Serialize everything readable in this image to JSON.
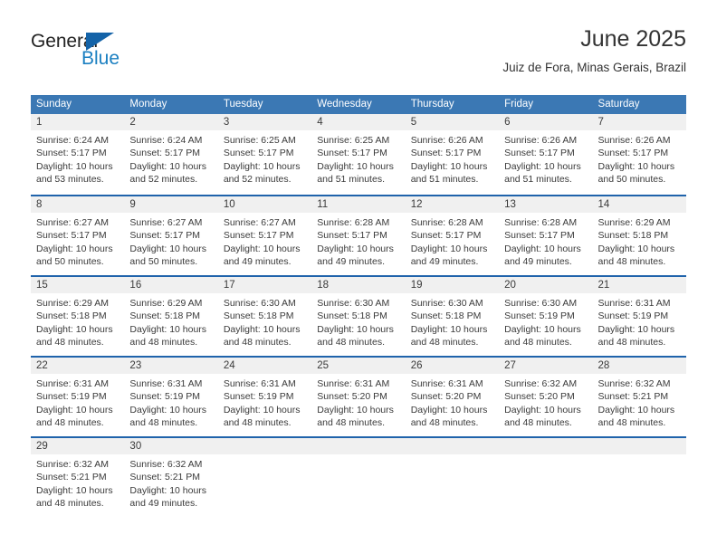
{
  "brand": {
    "name_part1": "General",
    "name_part2": "Blue",
    "triangle_icon": "triangle-icon",
    "color_primary": "#1463a8",
    "color_text": "#222222"
  },
  "header": {
    "title": "June 2025",
    "location": "Juiz de Fora, Minas Gerais, Brazil"
  },
  "theme": {
    "header_blue": "#3b78b4",
    "row_divider_blue": "#1f63ab",
    "day_band_gray": "#f0f0f0"
  },
  "weekdays": [
    "Sunday",
    "Monday",
    "Tuesday",
    "Wednesday",
    "Thursday",
    "Friday",
    "Saturday"
  ],
  "weeks": [
    [
      {
        "day": "1",
        "sunrise": "Sunrise: 6:24 AM",
        "sunset": "Sunset: 5:17 PM",
        "daylight1": "Daylight: 10 hours",
        "daylight2": "and 53 minutes."
      },
      {
        "day": "2",
        "sunrise": "Sunrise: 6:24 AM",
        "sunset": "Sunset: 5:17 PM",
        "daylight1": "Daylight: 10 hours",
        "daylight2": "and 52 minutes."
      },
      {
        "day": "3",
        "sunrise": "Sunrise: 6:25 AM",
        "sunset": "Sunset: 5:17 PM",
        "daylight1": "Daylight: 10 hours",
        "daylight2": "and 52 minutes."
      },
      {
        "day": "4",
        "sunrise": "Sunrise: 6:25 AM",
        "sunset": "Sunset: 5:17 PM",
        "daylight1": "Daylight: 10 hours",
        "daylight2": "and 51 minutes."
      },
      {
        "day": "5",
        "sunrise": "Sunrise: 6:26 AM",
        "sunset": "Sunset: 5:17 PM",
        "daylight1": "Daylight: 10 hours",
        "daylight2": "and 51 minutes."
      },
      {
        "day": "6",
        "sunrise": "Sunrise: 6:26 AM",
        "sunset": "Sunset: 5:17 PM",
        "daylight1": "Daylight: 10 hours",
        "daylight2": "and 51 minutes."
      },
      {
        "day": "7",
        "sunrise": "Sunrise: 6:26 AM",
        "sunset": "Sunset: 5:17 PM",
        "daylight1": "Daylight: 10 hours",
        "daylight2": "and 50 minutes."
      }
    ],
    [
      {
        "day": "8",
        "sunrise": "Sunrise: 6:27 AM",
        "sunset": "Sunset: 5:17 PM",
        "daylight1": "Daylight: 10 hours",
        "daylight2": "and 50 minutes."
      },
      {
        "day": "9",
        "sunrise": "Sunrise: 6:27 AM",
        "sunset": "Sunset: 5:17 PM",
        "daylight1": "Daylight: 10 hours",
        "daylight2": "and 50 minutes."
      },
      {
        "day": "10",
        "sunrise": "Sunrise: 6:27 AM",
        "sunset": "Sunset: 5:17 PM",
        "daylight1": "Daylight: 10 hours",
        "daylight2": "and 49 minutes."
      },
      {
        "day": "11",
        "sunrise": "Sunrise: 6:28 AM",
        "sunset": "Sunset: 5:17 PM",
        "daylight1": "Daylight: 10 hours",
        "daylight2": "and 49 minutes."
      },
      {
        "day": "12",
        "sunrise": "Sunrise: 6:28 AM",
        "sunset": "Sunset: 5:17 PM",
        "daylight1": "Daylight: 10 hours",
        "daylight2": "and 49 minutes."
      },
      {
        "day": "13",
        "sunrise": "Sunrise: 6:28 AM",
        "sunset": "Sunset: 5:17 PM",
        "daylight1": "Daylight: 10 hours",
        "daylight2": "and 49 minutes."
      },
      {
        "day": "14",
        "sunrise": "Sunrise: 6:29 AM",
        "sunset": "Sunset: 5:18 PM",
        "daylight1": "Daylight: 10 hours",
        "daylight2": "and 48 minutes."
      }
    ],
    [
      {
        "day": "15",
        "sunrise": "Sunrise: 6:29 AM",
        "sunset": "Sunset: 5:18 PM",
        "daylight1": "Daylight: 10 hours",
        "daylight2": "and 48 minutes."
      },
      {
        "day": "16",
        "sunrise": "Sunrise: 6:29 AM",
        "sunset": "Sunset: 5:18 PM",
        "daylight1": "Daylight: 10 hours",
        "daylight2": "and 48 minutes."
      },
      {
        "day": "17",
        "sunrise": "Sunrise: 6:30 AM",
        "sunset": "Sunset: 5:18 PM",
        "daylight1": "Daylight: 10 hours",
        "daylight2": "and 48 minutes."
      },
      {
        "day": "18",
        "sunrise": "Sunrise: 6:30 AM",
        "sunset": "Sunset: 5:18 PM",
        "daylight1": "Daylight: 10 hours",
        "daylight2": "and 48 minutes."
      },
      {
        "day": "19",
        "sunrise": "Sunrise: 6:30 AM",
        "sunset": "Sunset: 5:18 PM",
        "daylight1": "Daylight: 10 hours",
        "daylight2": "and 48 minutes."
      },
      {
        "day": "20",
        "sunrise": "Sunrise: 6:30 AM",
        "sunset": "Sunset: 5:19 PM",
        "daylight1": "Daylight: 10 hours",
        "daylight2": "and 48 minutes."
      },
      {
        "day": "21",
        "sunrise": "Sunrise: 6:31 AM",
        "sunset": "Sunset: 5:19 PM",
        "daylight1": "Daylight: 10 hours",
        "daylight2": "and 48 minutes."
      }
    ],
    [
      {
        "day": "22",
        "sunrise": "Sunrise: 6:31 AM",
        "sunset": "Sunset: 5:19 PM",
        "daylight1": "Daylight: 10 hours",
        "daylight2": "and 48 minutes."
      },
      {
        "day": "23",
        "sunrise": "Sunrise: 6:31 AM",
        "sunset": "Sunset: 5:19 PM",
        "daylight1": "Daylight: 10 hours",
        "daylight2": "and 48 minutes."
      },
      {
        "day": "24",
        "sunrise": "Sunrise: 6:31 AM",
        "sunset": "Sunset: 5:19 PM",
        "daylight1": "Daylight: 10 hours",
        "daylight2": "and 48 minutes."
      },
      {
        "day": "25",
        "sunrise": "Sunrise: 6:31 AM",
        "sunset": "Sunset: 5:20 PM",
        "daylight1": "Daylight: 10 hours",
        "daylight2": "and 48 minutes."
      },
      {
        "day": "26",
        "sunrise": "Sunrise: 6:31 AM",
        "sunset": "Sunset: 5:20 PM",
        "daylight1": "Daylight: 10 hours",
        "daylight2": "and 48 minutes."
      },
      {
        "day": "27",
        "sunrise": "Sunrise: 6:32 AM",
        "sunset": "Sunset: 5:20 PM",
        "daylight1": "Daylight: 10 hours",
        "daylight2": "and 48 minutes."
      },
      {
        "day": "28",
        "sunrise": "Sunrise: 6:32 AM",
        "sunset": "Sunset: 5:21 PM",
        "daylight1": "Daylight: 10 hours",
        "daylight2": "and 48 minutes."
      }
    ],
    [
      {
        "day": "29",
        "sunrise": "Sunrise: 6:32 AM",
        "sunset": "Sunset: 5:21 PM",
        "daylight1": "Daylight: 10 hours",
        "daylight2": "and 48 minutes."
      },
      {
        "day": "30",
        "sunrise": "Sunrise: 6:32 AM",
        "sunset": "Sunset: 5:21 PM",
        "daylight1": "Daylight: 10 hours",
        "daylight2": "and 49 minutes."
      },
      {
        "day": "",
        "sunrise": "",
        "sunset": "",
        "daylight1": "",
        "daylight2": ""
      },
      {
        "day": "",
        "sunrise": "",
        "sunset": "",
        "daylight1": "",
        "daylight2": ""
      },
      {
        "day": "",
        "sunrise": "",
        "sunset": "",
        "daylight1": "",
        "daylight2": ""
      },
      {
        "day": "",
        "sunrise": "",
        "sunset": "",
        "daylight1": "",
        "daylight2": ""
      },
      {
        "day": "",
        "sunrise": "",
        "sunset": "",
        "daylight1": "",
        "daylight2": ""
      }
    ]
  ]
}
